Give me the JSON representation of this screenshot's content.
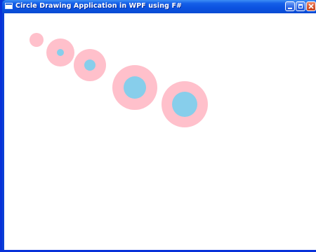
{
  "window": {
    "title": "Circle Drawing Application in WPF using F#"
  },
  "icons": {
    "app": "app-window-icon",
    "minimize": "minimize-icon",
    "maximize": "maximize-icon",
    "close": "close-icon"
  },
  "colors": {
    "outer_circle": "#ffc0cb",
    "inner_circle": "#87ceeb",
    "canvas_background": "#ffffff"
  },
  "circles_drawn": 5
}
